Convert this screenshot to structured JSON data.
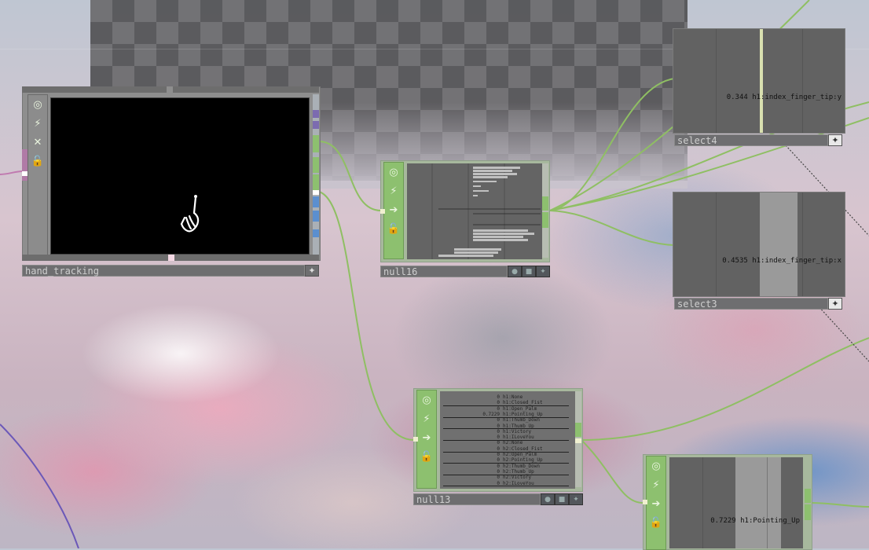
{
  "nodes": {
    "hand_tracking": {
      "label": "hand_tracking"
    },
    "null16": {
      "label": "null16"
    },
    "null13": {
      "label": "null13",
      "rows": [
        {
          "value": "0",
          "name": "h1:None"
        },
        {
          "value": "0",
          "name": "h1:Closed_Fist"
        },
        {
          "value": "0",
          "name": "h1:Open_Palm"
        },
        {
          "value": "0.7229",
          "name": "h1:Pointing_Up"
        },
        {
          "value": "0",
          "name": "h1:Thumb_Down"
        },
        {
          "value": "0",
          "name": "h1:Thumb_Up"
        },
        {
          "value": "0",
          "name": "h1:Victory"
        },
        {
          "value": "0",
          "name": "h1:ILoveYou"
        },
        {
          "value": "0",
          "name": "h2:None"
        },
        {
          "value": "0",
          "name": "h2:Closed_Fist"
        },
        {
          "value": "0",
          "name": "h2:Open_Palm"
        },
        {
          "value": "0",
          "name": "h2:Pointing_Up"
        },
        {
          "value": "0",
          "name": "h2:Thumb_Down"
        },
        {
          "value": "0",
          "name": "h2:Thumb_Up"
        },
        {
          "value": "0",
          "name": "h2:Victory"
        },
        {
          "value": "0",
          "name": "h2:ILoveYou"
        }
      ]
    },
    "select4": {
      "label": "select4",
      "value": "0.344",
      "channel": "h1:index_finger_tip:y"
    },
    "select3": {
      "label": "select3",
      "value": "0.4535",
      "channel": "h1:index_finger_tip:x"
    },
    "bottom_right": {
      "value": "0.7229",
      "channel": "h1:Pointing_Up"
    }
  },
  "icons": {
    "viewer": "◎",
    "bypass": "⚡",
    "cook": "✕",
    "lock": "🔓",
    "display": "➔",
    "plus": "✦"
  },
  "colors": {
    "wire": "#8fbf63",
    "chop": "#8dc06f",
    "top": "#8c8c8c"
  }
}
